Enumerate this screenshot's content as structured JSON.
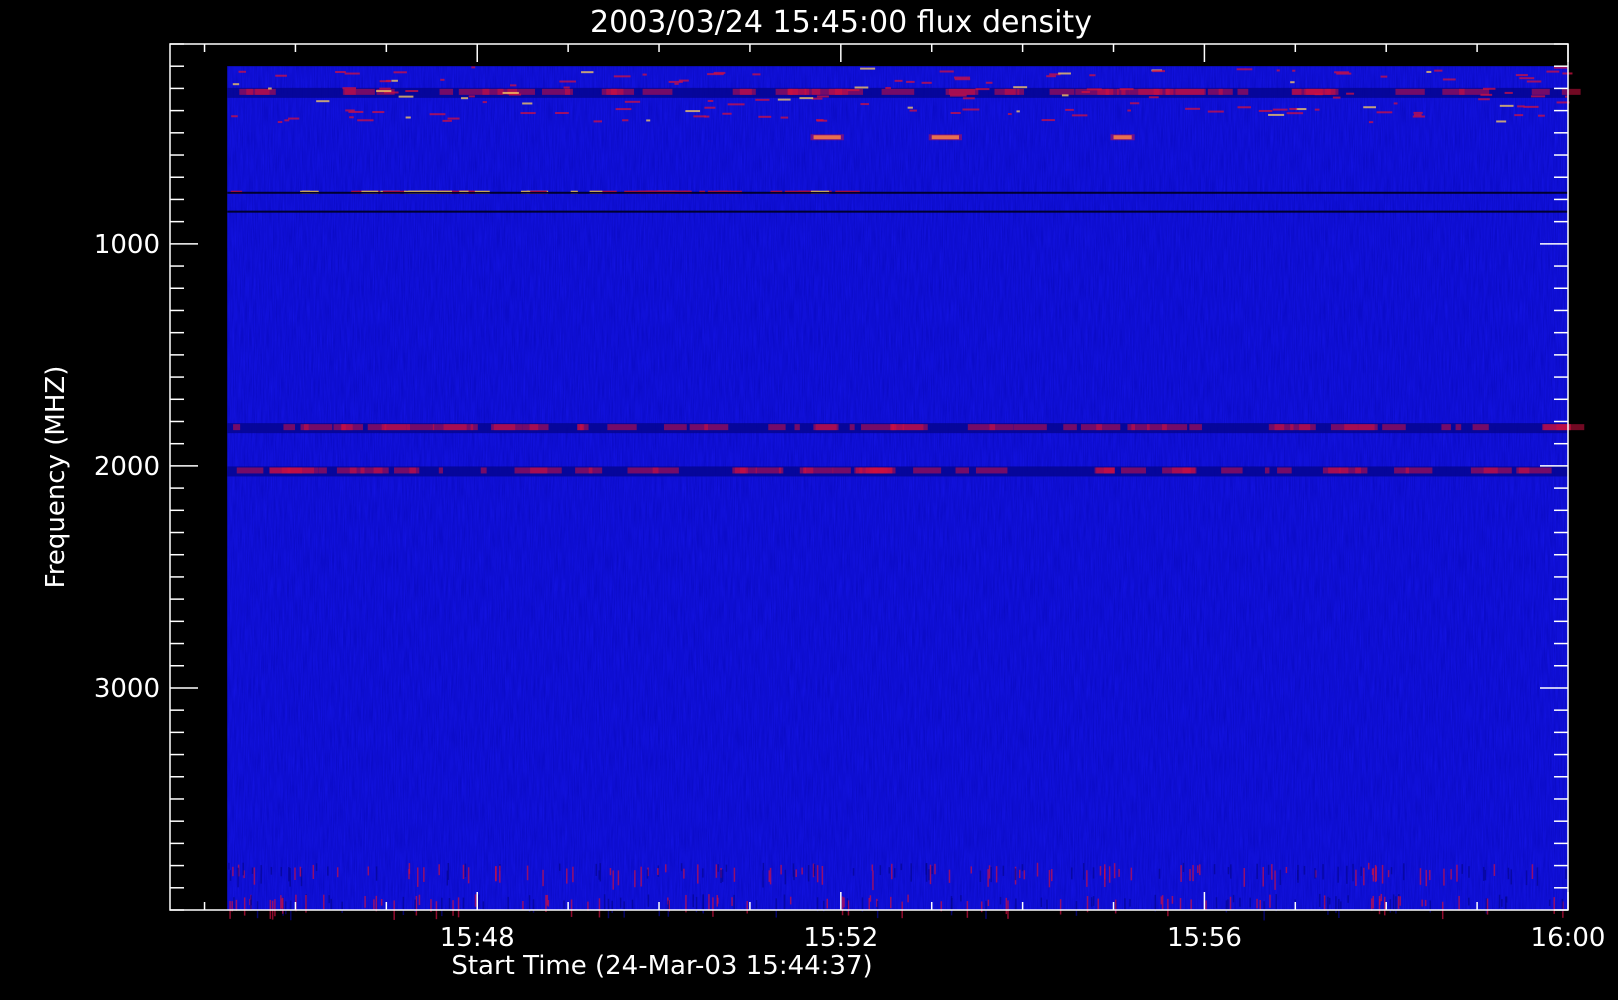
{
  "chart_data": {
    "type": "heatmap",
    "title": "2003/03/24 15:45:00 flux density",
    "xlabel": "Start Time (24-Mar-03 15:44:37)",
    "ylabel": "Frequency (MHZ)",
    "x_range_min": [
      944.62,
      960
    ],
    "x_data_extent_min": [
      945.25,
      960
    ],
    "y_range_mhz": [
      100,
      4000
    ],
    "y_data_extent_mhz": [
      200,
      4000
    ],
    "y_reversed": true,
    "grid": false,
    "x_ticks": [
      {
        "value_min": 948,
        "label": "15:48"
      },
      {
        "value_min": 952,
        "label": "15:52"
      },
      {
        "value_min": 956,
        "label": "15:56"
      },
      {
        "value_min": 960,
        "label": "16:00"
      }
    ],
    "y_ticks": [
      {
        "value": 1000,
        "label": "1000"
      },
      {
        "value": 2000,
        "label": "2000"
      },
      {
        "value": 3000,
        "label": "3000"
      }
    ],
    "colors": {
      "background": "#000000",
      "axes": "#ffffff",
      "field": "#1414e6",
      "field_low": "#050590",
      "enhanced": "#d01040",
      "peak": "#ffd060"
    },
    "features": [
      {
        "kind": "dark-band",
        "freq_mhz": 320,
        "t_min": [
          945.25,
          960
        ]
      },
      {
        "kind": "red-band",
        "freq_mhz": 770,
        "t_min": [
          945.25,
          952
        ]
      },
      {
        "kind": "dark-line",
        "freq_mhz": 770,
        "t_min": [
          945.25,
          960
        ]
      },
      {
        "kind": "dark-line",
        "freq_mhz": 855,
        "t_min": [
          945.25,
          960
        ]
      },
      {
        "kind": "dark-band",
        "freq_mhz": 1830,
        "t_min": [
          945.25,
          960
        ]
      },
      {
        "kind": "dark-band",
        "freq_mhz": 2025,
        "t_min": [
          945.25,
          960
        ]
      },
      {
        "kind": "peak",
        "freq_mhz": 520,
        "t_min": [
          951.7,
          952.0
        ]
      },
      {
        "kind": "peak",
        "freq_mhz": 520,
        "t_min": [
          953.0,
          953.3
        ]
      },
      {
        "kind": "peak",
        "freq_mhz": 520,
        "t_min": [
          955.0,
          955.2
        ]
      },
      {
        "kind": "noisy-band",
        "freq_mhz": 3850,
        "t_min": [
          945.25,
          960
        ]
      },
      {
        "kind": "noisy-band",
        "freq_mhz": 3990,
        "t_min": [
          945.25,
          960
        ]
      }
    ]
  }
}
